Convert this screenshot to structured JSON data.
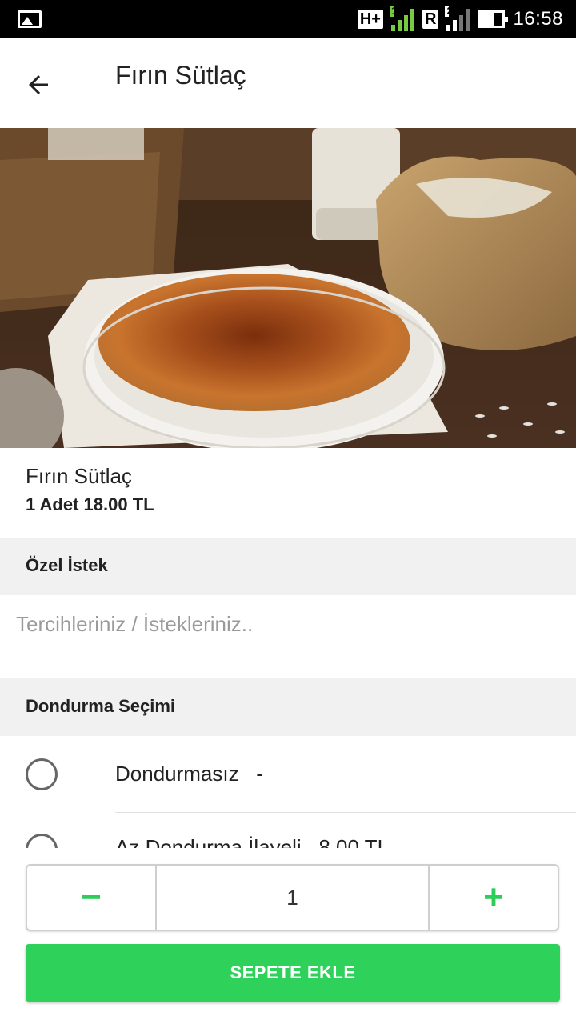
{
  "status_bar": {
    "network": "H+",
    "sim1": "1",
    "roaming": "R",
    "sim2": "2",
    "time": "16:58"
  },
  "header": {
    "title": "Fırın Sütlaç",
    "back_icon": "arrow-left-icon"
  },
  "product": {
    "name": "Fırın Sütlaç",
    "quantity_price": "1 Adet  18.00 TL"
  },
  "special_request": {
    "heading": "Özel İstek",
    "placeholder": "Tercihleriniz / İstekleriniz..",
    "value": ""
  },
  "ice_cream": {
    "heading": "Dondurma Seçimi",
    "options": [
      {
        "label": "Dondurmasız   -",
        "selected": false
      },
      {
        "label": "Az Dondurma İlaveli   8.00 TL",
        "selected": false
      }
    ]
  },
  "quantity": {
    "minus": "−",
    "value": "1",
    "plus": "+"
  },
  "add_to_cart": "SEPETE EKLE",
  "colors": {
    "accent": "#2ed15a",
    "section_bg": "#f1f1f1"
  }
}
